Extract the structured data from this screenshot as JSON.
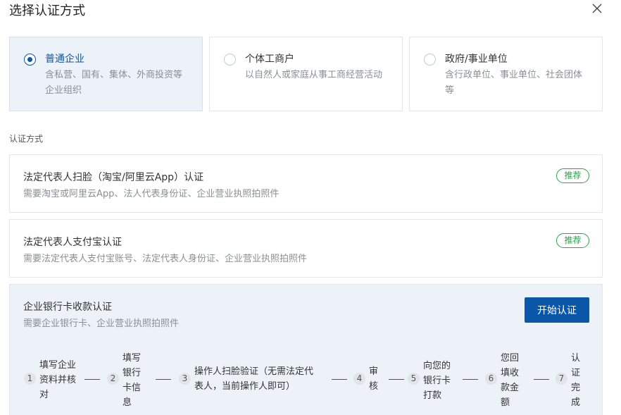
{
  "dialog": {
    "title": "选择认证方式",
    "close_icon": "close-icon"
  },
  "entity_types": [
    {
      "label": "普通企业",
      "desc": "含私营、国有、集体、外商投资等企业组织",
      "selected": true
    },
    {
      "label": "个体工商户",
      "desc": "以自然人或家庭从事工商经营活动",
      "selected": false
    },
    {
      "label": "政府/事业单位",
      "desc": "含行政单位、事业单位、社会团体等",
      "selected": false
    }
  ],
  "methods_label": "认证方式",
  "methods": [
    {
      "title": "法定代表人扫脸（淘宝/阿里云App）认证",
      "desc": "需要淘宝或阿里云App、法人代表身份证、企业营业执照拍照件",
      "badge": "推荐"
    },
    {
      "title": "法定代表人支付宝认证",
      "desc": "需要法定代表人支付宝账号、法定代表人身份证、企业营业执照拍照件",
      "badge": "推荐"
    },
    {
      "title": "企业银行卡收款认证",
      "desc": "需要企业银行卡、企业营业执照拍照件",
      "button": "开始认证"
    }
  ],
  "steps": [
    {
      "num": "1",
      "text": "填写企业资料并核对"
    },
    {
      "num": "2",
      "text": "填写银行卡信息"
    },
    {
      "num": "3",
      "text": "操作人扫脸验证（无需法定代表人，当前操作人即可）"
    },
    {
      "num": "4",
      "text": "审核"
    },
    {
      "num": "5",
      "text": "向您的银行卡打款"
    },
    {
      "num": "6",
      "text": "您回填收款金额"
    },
    {
      "num": "7",
      "text": "认证完成"
    }
  ],
  "colors": {
    "accent": "#0a56a8",
    "recommend": "#2aa34a",
    "selected_bg": "#edf2f8"
  }
}
